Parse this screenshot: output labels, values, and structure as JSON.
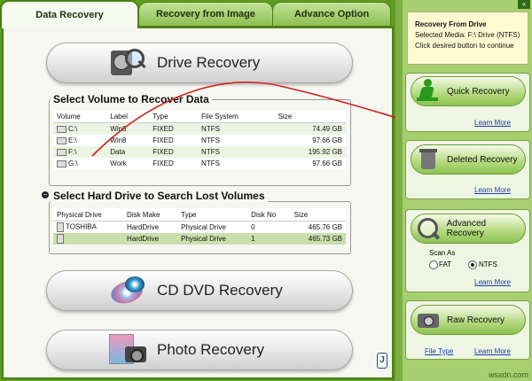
{
  "tabs": [
    {
      "label": "Data Recovery"
    },
    {
      "label": "Recovery from Image"
    },
    {
      "label": "Advance Option"
    }
  ],
  "buttons": {
    "drive_recovery": "Drive Recovery",
    "cd_dvd_recovery": "CD DVD Recovery",
    "photo_recovery": "Photo Recovery"
  },
  "volumes": {
    "title": "Select Volume to Recover Data",
    "headers": [
      "Volume",
      "Label",
      "Type",
      "File System",
      "Size"
    ],
    "rows": [
      [
        "C:\\",
        "Win8",
        "FIXED",
        "NTFS",
        "74.49 GB"
      ],
      [
        "E:\\",
        "Win8",
        "FIXED",
        "NTFS",
        "97.66 GB"
      ],
      [
        "F:\\",
        "Data",
        "FIXED",
        "NTFS",
        "195.92 GB"
      ],
      [
        "G:\\",
        "Work",
        "FIXED",
        "NTFS",
        "97.66 GB"
      ]
    ]
  },
  "hard_drives": {
    "title": "Select Hard Drive to Search Lost Volumes",
    "headers": [
      "Physical Drive",
      "Disk Make",
      "Type",
      "Disk No",
      "Size"
    ],
    "rows": [
      [
        "TOSHIBA",
        "HardDrive",
        "Physical Drive",
        "0",
        "465.76 GB"
      ],
      [
        "",
        "HardDrive",
        "Physical Drive",
        "1",
        "465.73 GB"
      ]
    ]
  },
  "info": {
    "title": "Recovery From Drive",
    "line1": "Selected Media: F:\\ Drive (NTFS)",
    "line2": "Click desired button to continue"
  },
  "side": {
    "quick": "Quick Recovery",
    "deleted": "Deleted Recovery",
    "advanced": "Advanced Recovery",
    "raw": "Raw Recovery",
    "learn_more": "Learn More",
    "scan_as": "Scan As",
    "fat": "FAT",
    "ntfs": "NTFS",
    "file_type": "File Type",
    "collapse": "«"
  },
  "watermark": "wsxdn.com"
}
